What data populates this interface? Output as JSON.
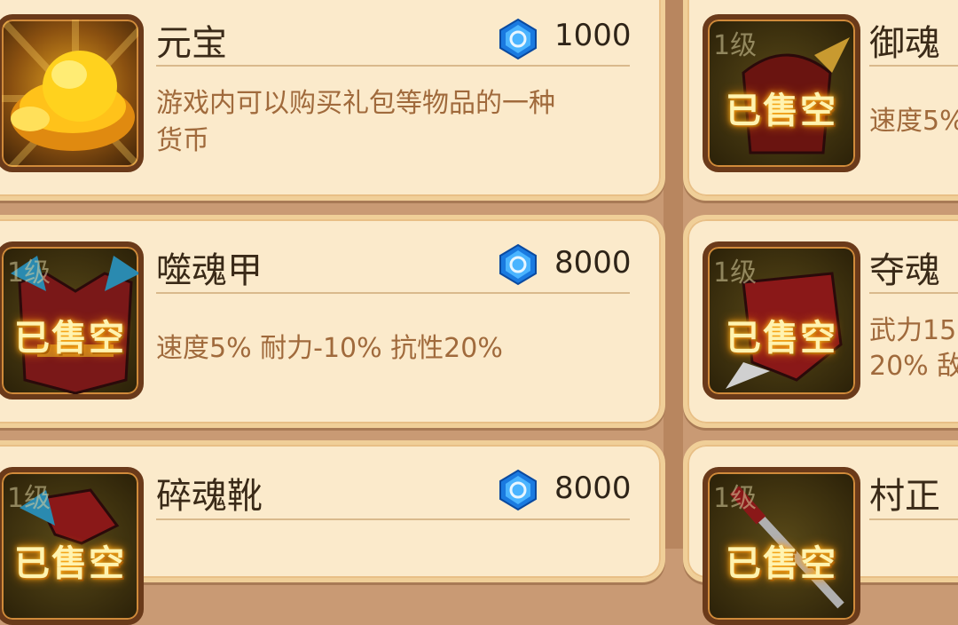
{
  "items_left": [
    {
      "name": "元宝",
      "price": "1000",
      "desc_line1": "游戏内可以购买礼包等物品的一种",
      "desc_line2": "货币",
      "level": "",
      "status": "",
      "icon": "gold-ingot-icon"
    },
    {
      "name": "噬魂甲",
      "price": "8000",
      "desc_line1": "速度5%  耐力-10%  抗性20%",
      "desc_line2": "",
      "level": "1级",
      "status": "已售空",
      "icon": "armor-icon"
    },
    {
      "name": "碎魂靴",
      "price": "8000",
      "desc_line1": "",
      "desc_line2": "",
      "level": "1级",
      "status": "已售空",
      "icon": "boots-icon"
    }
  ],
  "items_right": [
    {
      "name": "御魂",
      "desc_line1": "速度5%",
      "desc_line2": "",
      "level": "1级",
      "status": "已售空",
      "icon": "helmet-icon"
    },
    {
      "name": "夺魂",
      "desc_line1": "武力15",
      "desc_line2": "20%  敌",
      "level": "1级",
      "status": "已售空",
      "icon": "claw-icon"
    },
    {
      "name": "村正",
      "desc_line1": "",
      "desc_line2": "",
      "level": "1级",
      "status": "已售空",
      "icon": "sword-icon"
    }
  ],
  "currency_icon": "blue-gem-icon",
  "colors": {
    "background": "#c99a74",
    "card": "#fbeacb",
    "accent_text": "#a06a3c"
  }
}
